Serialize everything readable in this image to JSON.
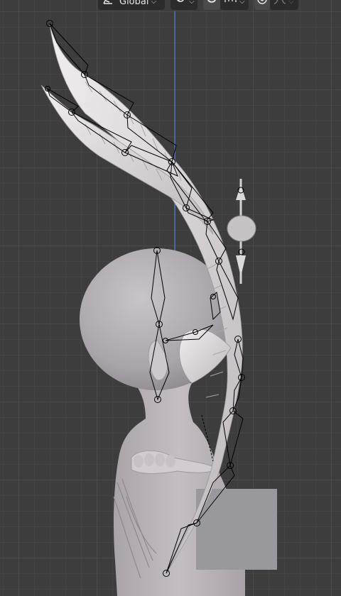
{
  "header": {
    "transform_orientation": {
      "icon": "orientation-icon",
      "label": "Global"
    },
    "pivot": {
      "icon": "pivot-point-icon"
    },
    "snapping": {
      "icon": "magnet-icon",
      "increment_icon": "snap-increment-icon"
    },
    "proportional": {
      "icon": "proportional-editing-icon",
      "falloff_icon": "falloff-curve-icon"
    }
  },
  "colors": {
    "grid_bg": "#3d3d3d",
    "axis_line": "#4f73b8",
    "mesh": "#d9d6d8",
    "bone_outline": "#000000",
    "gray_box": "#99999d"
  }
}
